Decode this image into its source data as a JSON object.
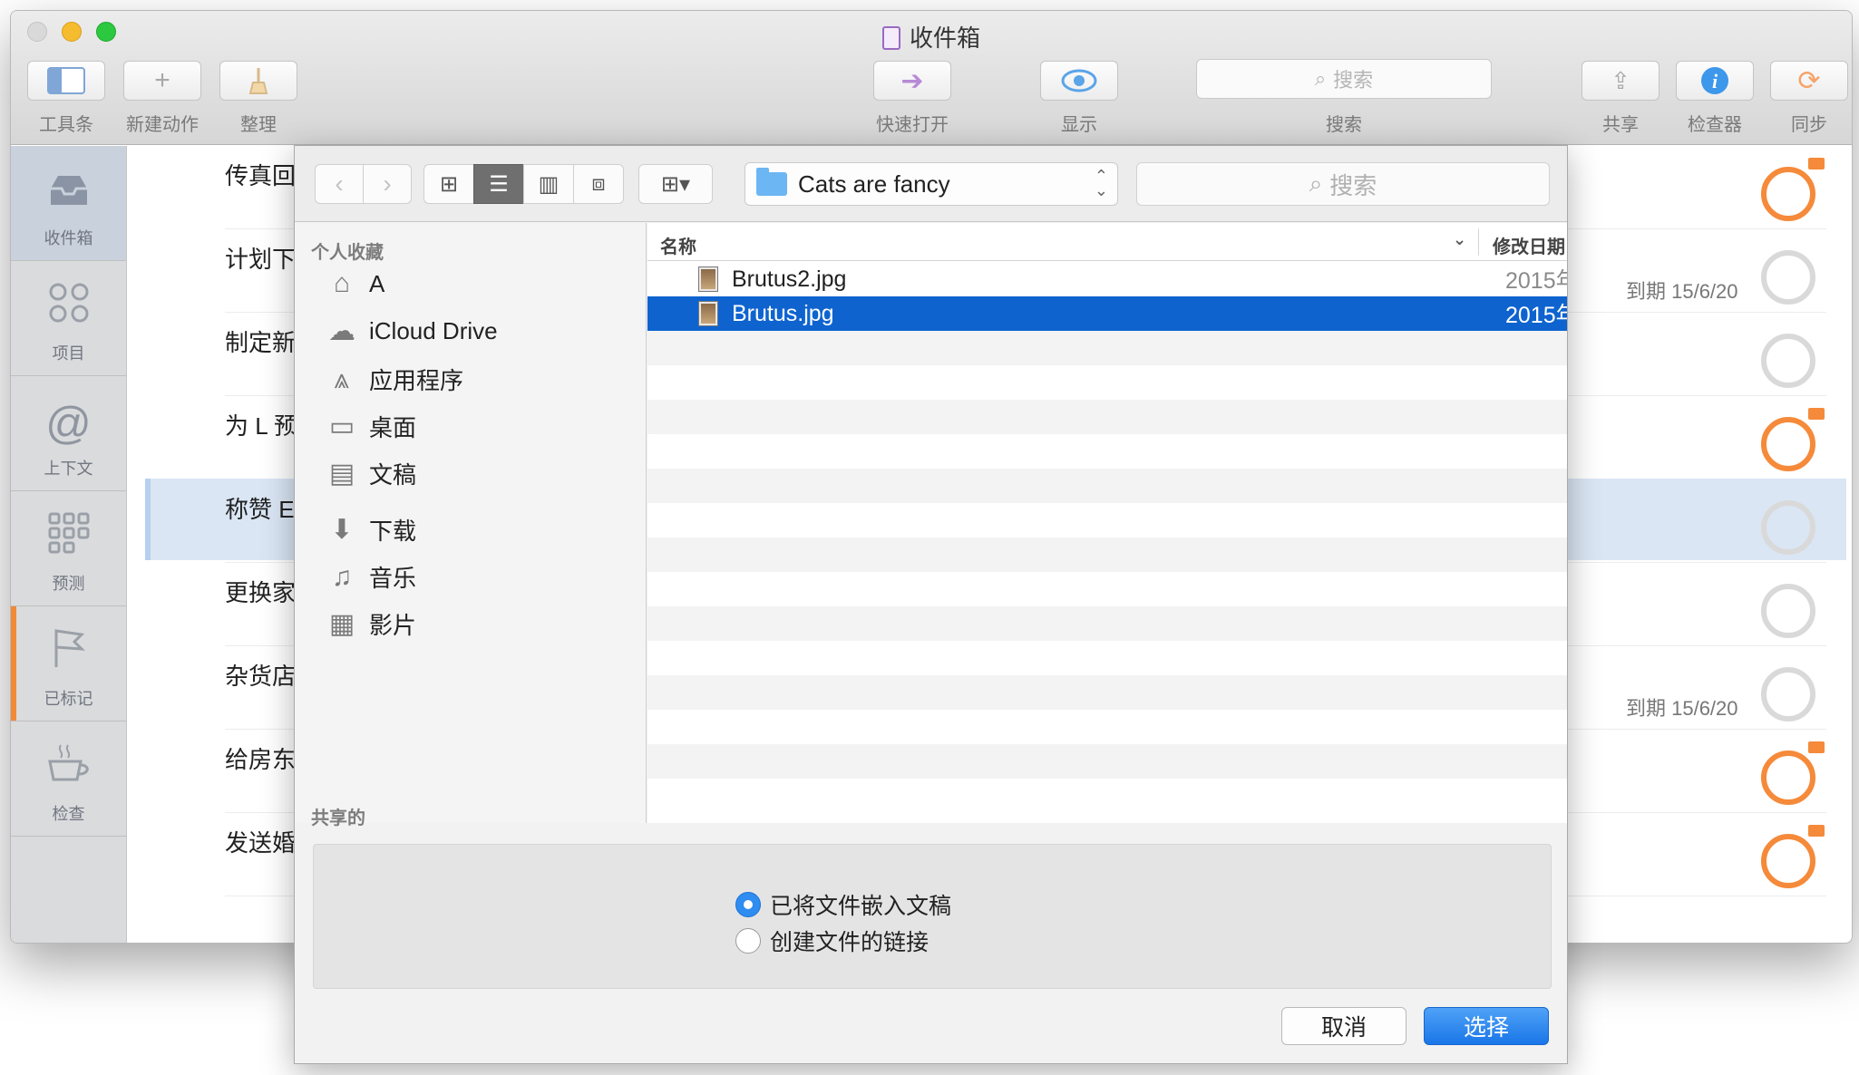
{
  "window": {
    "title": "收件箱"
  },
  "toolbar": {
    "items": [
      {
        "label": "工具条",
        "icon": "sidebar-toggle-icon"
      },
      {
        "label": "新建动作",
        "icon": "plus-icon"
      },
      {
        "label": "整理",
        "icon": "broom-icon"
      },
      {
        "label": "快速打开",
        "icon": "arrow-right-icon"
      },
      {
        "label": "显示",
        "icon": "eye-icon"
      },
      {
        "label": "共享",
        "icon": "share-icon"
      },
      {
        "label": "检查器",
        "icon": "info-icon"
      },
      {
        "label": "同步",
        "icon": "sync-icon"
      }
    ],
    "search_placeholder": "搜索",
    "search_label": "搜索"
  },
  "rail": [
    {
      "label": "收件箱",
      "icon": "inbox-icon",
      "active": true
    },
    {
      "label": "项目",
      "icon": "projects-icon"
    },
    {
      "label": "上下文",
      "icon": "at-icon"
    },
    {
      "label": "预测",
      "icon": "forecast-icon"
    },
    {
      "label": "已标记",
      "icon": "flag-icon"
    },
    {
      "label": "检查",
      "icon": "coffee-cup-icon"
    }
  ],
  "tasks": [
    {
      "title": "传真回",
      "status": "flagged"
    },
    {
      "title": "计划下",
      "status": "normal",
      "due": "到期 15/6/20"
    },
    {
      "title": "制定新",
      "status": "normal"
    },
    {
      "title": "为 L 预",
      "status": "flagged"
    },
    {
      "title": "称赞 E",
      "status": "normal",
      "selected": true
    },
    {
      "title": "更换家",
      "status": "normal"
    },
    {
      "title": "杂货店",
      "status": "normal",
      "due": "到期 15/6/20"
    },
    {
      "title": "给房东",
      "status": "flagged"
    },
    {
      "title": "发送婚",
      "status": "flagged"
    }
  ],
  "sheet": {
    "path": "Cats are fancy",
    "search_placeholder": "搜索",
    "sidebar": {
      "favorites_heading": "个人收藏",
      "favorites": [
        {
          "label": "A",
          "icon": "home-icon"
        },
        {
          "label": "iCloud Drive",
          "icon": "cloud-icon"
        },
        {
          "label": "应用程序",
          "icon": "applications-icon"
        },
        {
          "label": "桌面",
          "icon": "desktop-icon"
        },
        {
          "label": "文稿",
          "icon": "documents-icon"
        },
        {
          "label": "下载",
          "icon": "download-icon"
        },
        {
          "label": "音乐",
          "icon": "music-icon"
        },
        {
          "label": "影片",
          "icon": "movies-icon"
        }
      ],
      "shared_heading": "共享的"
    },
    "columns": {
      "name": "名称",
      "date": "修改日期"
    },
    "files": [
      {
        "name": "Brutus2.jpg",
        "date": "2015年",
        "selected": false
      },
      {
        "name": "Brutus.jpg",
        "date": "2015年",
        "selected": true
      }
    ],
    "options": [
      {
        "label": "已将文件嵌入文稿",
        "checked": true
      },
      {
        "label": "创建文件的链接",
        "checked": false
      }
    ],
    "cancel_label": "取消",
    "choose_label": "选择"
  }
}
